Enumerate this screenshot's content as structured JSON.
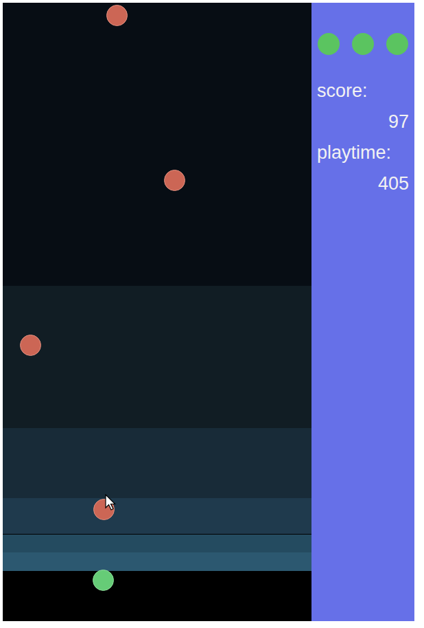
{
  "lives": [
    {
      "filled": true,
      "color": "#5bc460"
    },
    {
      "filled": true,
      "color": "#5bc460"
    },
    {
      "filled": true,
      "color": "#5bc460"
    }
  ],
  "stats": [
    {
      "label": "score:",
      "value": "97"
    },
    {
      "label": "playtime:",
      "value": "405"
    }
  ],
  "balls": [
    {
      "kind": "enemy",
      "color": "#cc6655"
    },
    {
      "kind": "enemy",
      "color": "#cc6655"
    },
    {
      "kind": "enemy",
      "color": "#cc6655"
    },
    {
      "kind": "enemy",
      "color": "#cc6655"
    },
    {
      "kind": "player",
      "color": "#66cc77"
    }
  ]
}
